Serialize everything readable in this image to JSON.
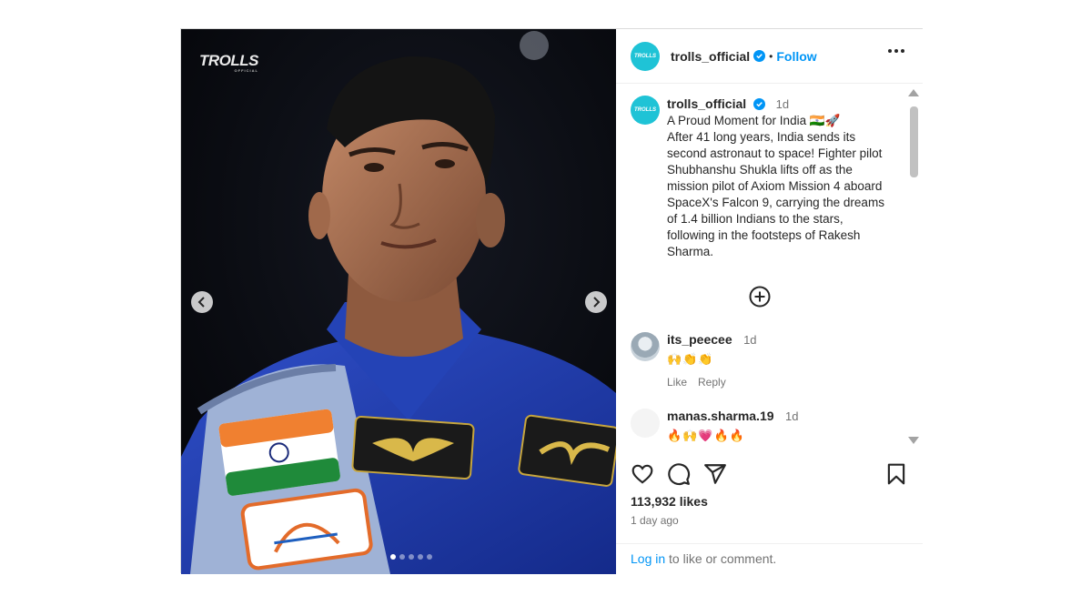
{
  "post": {
    "username": "trolls_official",
    "avatar_text": "TROLLS",
    "follow_label": "Follow",
    "separator": "•",
    "image": {
      "brand_logo": "TROLLS",
      "brand_logo_sub": "OFFICIAL",
      "slide_count": 5,
      "active_slide": 1
    },
    "caption": {
      "username": "trolls_official",
      "time": "1d",
      "lines": [
        "A Proud Moment for India 🇮🇳🚀",
        "After 41 long years, India sends its second astronaut to space! Fighter pilot Shubhanshu Shukla lifts off as the mission pilot of Axiom Mission 4 aboard SpaceX's Falcon 9, carrying the dreams of 1.4 billion Indians to the stars, following in the footsteps of Rakesh Sharma."
      ]
    },
    "comments": [
      {
        "username": "its_peecee",
        "time": "1d",
        "text": "🙌👏👏",
        "like_label": "Like",
        "reply_label": "Reply"
      },
      {
        "username": "manas.sharma.19",
        "time": "1d",
        "text": "🔥🙌💗🔥🔥"
      }
    ],
    "likes": "113,932 likes",
    "posted_ago": "1 day ago",
    "login_link": "Log in",
    "login_rest": " to like or comment."
  },
  "colors": {
    "accent": "#0095f6",
    "avatar_brand": "#1fc3d6",
    "muted": "#737373"
  },
  "icons": [
    "verified-badge-icon",
    "more-options-icon",
    "add-comment-icon",
    "heart-icon",
    "comment-icon",
    "share-icon",
    "bookmark-icon",
    "chevron-left-icon",
    "chevron-right-icon"
  ]
}
